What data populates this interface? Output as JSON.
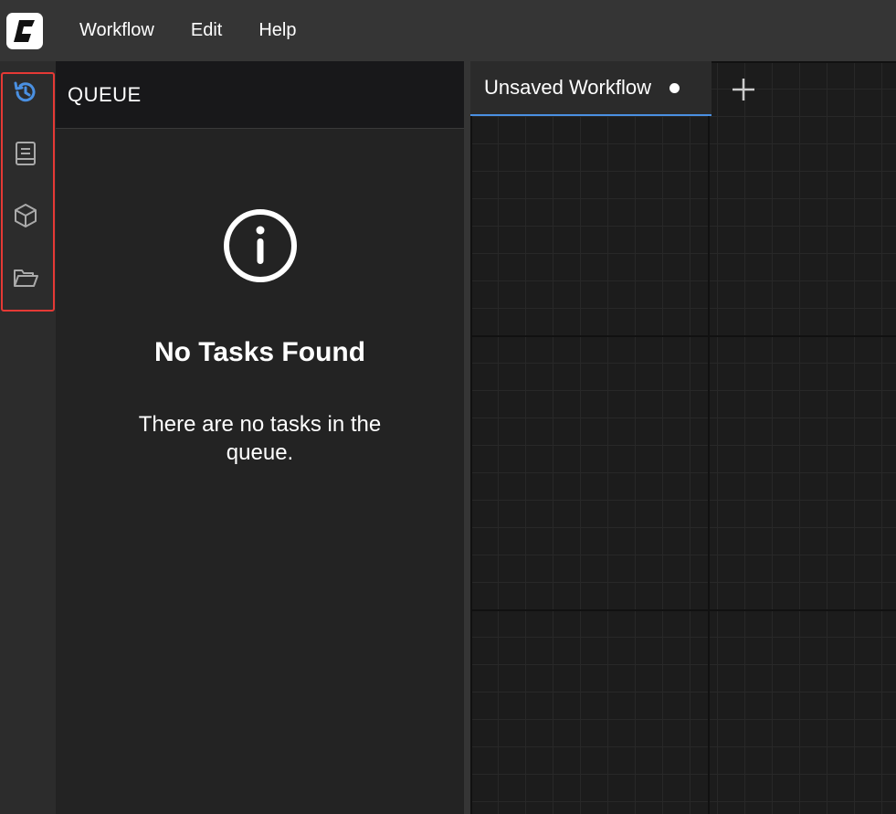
{
  "menu": {
    "items": [
      {
        "label": "Workflow"
      },
      {
        "label": "Edit"
      },
      {
        "label": "Help"
      }
    ]
  },
  "sidebar": {
    "items": [
      {
        "icon": "history-icon",
        "active": true
      },
      {
        "icon": "book-icon",
        "active": false
      },
      {
        "icon": "cube-icon",
        "active": false
      },
      {
        "icon": "folder-open-icon",
        "active": false
      }
    ]
  },
  "queue_panel": {
    "title": "QUEUE",
    "empty_title": "No Tasks Found",
    "empty_message": "There are no tasks in the queue."
  },
  "tabs": [
    {
      "label": "Unsaved Workflow",
      "unsaved": true
    }
  ],
  "colors": {
    "accent": "#4a90e2",
    "highlight": "#e53935"
  }
}
